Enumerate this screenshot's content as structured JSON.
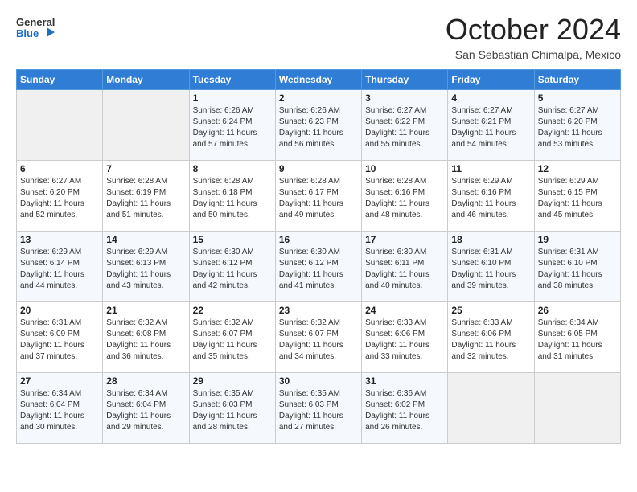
{
  "logo": {
    "line1": "General",
    "line2": "Blue"
  },
  "header": {
    "month": "October 2024",
    "location": "San Sebastian Chimalpa, Mexico"
  },
  "weekdays": [
    "Sunday",
    "Monday",
    "Tuesday",
    "Wednesday",
    "Thursday",
    "Friday",
    "Saturday"
  ],
  "weeks": [
    [
      {
        "day": "",
        "info": ""
      },
      {
        "day": "",
        "info": ""
      },
      {
        "day": "1",
        "info": "Sunrise: 6:26 AM\nSunset: 6:24 PM\nDaylight: 11 hours and 57 minutes."
      },
      {
        "day": "2",
        "info": "Sunrise: 6:26 AM\nSunset: 6:23 PM\nDaylight: 11 hours and 56 minutes."
      },
      {
        "day": "3",
        "info": "Sunrise: 6:27 AM\nSunset: 6:22 PM\nDaylight: 11 hours and 55 minutes."
      },
      {
        "day": "4",
        "info": "Sunrise: 6:27 AM\nSunset: 6:21 PM\nDaylight: 11 hours and 54 minutes."
      },
      {
        "day": "5",
        "info": "Sunrise: 6:27 AM\nSunset: 6:20 PM\nDaylight: 11 hours and 53 minutes."
      }
    ],
    [
      {
        "day": "6",
        "info": "Sunrise: 6:27 AM\nSunset: 6:20 PM\nDaylight: 11 hours and 52 minutes."
      },
      {
        "day": "7",
        "info": "Sunrise: 6:28 AM\nSunset: 6:19 PM\nDaylight: 11 hours and 51 minutes."
      },
      {
        "day": "8",
        "info": "Sunrise: 6:28 AM\nSunset: 6:18 PM\nDaylight: 11 hours and 50 minutes."
      },
      {
        "day": "9",
        "info": "Sunrise: 6:28 AM\nSunset: 6:17 PM\nDaylight: 11 hours and 49 minutes."
      },
      {
        "day": "10",
        "info": "Sunrise: 6:28 AM\nSunset: 6:16 PM\nDaylight: 11 hours and 48 minutes."
      },
      {
        "day": "11",
        "info": "Sunrise: 6:29 AM\nSunset: 6:16 PM\nDaylight: 11 hours and 46 minutes."
      },
      {
        "day": "12",
        "info": "Sunrise: 6:29 AM\nSunset: 6:15 PM\nDaylight: 11 hours and 45 minutes."
      }
    ],
    [
      {
        "day": "13",
        "info": "Sunrise: 6:29 AM\nSunset: 6:14 PM\nDaylight: 11 hours and 44 minutes."
      },
      {
        "day": "14",
        "info": "Sunrise: 6:29 AM\nSunset: 6:13 PM\nDaylight: 11 hours and 43 minutes."
      },
      {
        "day": "15",
        "info": "Sunrise: 6:30 AM\nSunset: 6:12 PM\nDaylight: 11 hours and 42 minutes."
      },
      {
        "day": "16",
        "info": "Sunrise: 6:30 AM\nSunset: 6:12 PM\nDaylight: 11 hours and 41 minutes."
      },
      {
        "day": "17",
        "info": "Sunrise: 6:30 AM\nSunset: 6:11 PM\nDaylight: 11 hours and 40 minutes."
      },
      {
        "day": "18",
        "info": "Sunrise: 6:31 AM\nSunset: 6:10 PM\nDaylight: 11 hours and 39 minutes."
      },
      {
        "day": "19",
        "info": "Sunrise: 6:31 AM\nSunset: 6:10 PM\nDaylight: 11 hours and 38 minutes."
      }
    ],
    [
      {
        "day": "20",
        "info": "Sunrise: 6:31 AM\nSunset: 6:09 PM\nDaylight: 11 hours and 37 minutes."
      },
      {
        "day": "21",
        "info": "Sunrise: 6:32 AM\nSunset: 6:08 PM\nDaylight: 11 hours and 36 minutes."
      },
      {
        "day": "22",
        "info": "Sunrise: 6:32 AM\nSunset: 6:07 PM\nDaylight: 11 hours and 35 minutes."
      },
      {
        "day": "23",
        "info": "Sunrise: 6:32 AM\nSunset: 6:07 PM\nDaylight: 11 hours and 34 minutes."
      },
      {
        "day": "24",
        "info": "Sunrise: 6:33 AM\nSunset: 6:06 PM\nDaylight: 11 hours and 33 minutes."
      },
      {
        "day": "25",
        "info": "Sunrise: 6:33 AM\nSunset: 6:06 PM\nDaylight: 11 hours and 32 minutes."
      },
      {
        "day": "26",
        "info": "Sunrise: 6:34 AM\nSunset: 6:05 PM\nDaylight: 11 hours and 31 minutes."
      }
    ],
    [
      {
        "day": "27",
        "info": "Sunrise: 6:34 AM\nSunset: 6:04 PM\nDaylight: 11 hours and 30 minutes."
      },
      {
        "day": "28",
        "info": "Sunrise: 6:34 AM\nSunset: 6:04 PM\nDaylight: 11 hours and 29 minutes."
      },
      {
        "day": "29",
        "info": "Sunrise: 6:35 AM\nSunset: 6:03 PM\nDaylight: 11 hours and 28 minutes."
      },
      {
        "day": "30",
        "info": "Sunrise: 6:35 AM\nSunset: 6:03 PM\nDaylight: 11 hours and 27 minutes."
      },
      {
        "day": "31",
        "info": "Sunrise: 6:36 AM\nSunset: 6:02 PM\nDaylight: 11 hours and 26 minutes."
      },
      {
        "day": "",
        "info": ""
      },
      {
        "day": "",
        "info": ""
      }
    ]
  ]
}
